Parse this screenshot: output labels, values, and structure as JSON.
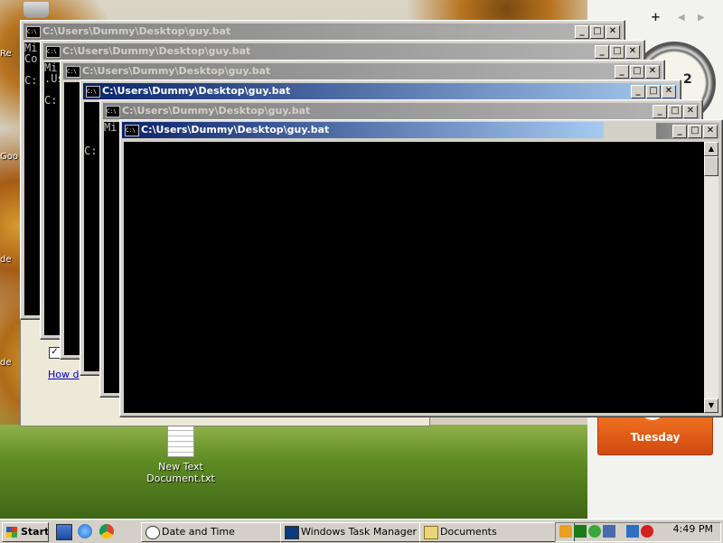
{
  "desktop": {
    "icons": [
      {
        "name": "New Text Document.txt",
        "label_line1": "New Text",
        "label_line2": "Document.txt"
      }
    ],
    "edge_labels": [
      "Re",
      "Goo",
      "de",
      "de"
    ]
  },
  "gadgets": {
    "toolbar": {
      "add": "+",
      "prev": "◀",
      "next": "▶"
    },
    "clock": {
      "visible_number": "2"
    },
    "calendar": {
      "day": "Tuesday"
    }
  },
  "date_time_dialog": {
    "link_text": "How d",
    "checkbox_checked": true
  },
  "console_windows": [
    {
      "title": "C:\\Users\\Dummy\\Desktop\\guy.bat",
      "active": false,
      "console_text": "Mi\nCo\n\nC:"
    },
    {
      "title": "C:\\Users\\Dummy\\Desktop\\guy.bat",
      "active": false,
      "console_text": "Mi\n.Us\n\nC:"
    },
    {
      "title": "C:\\Users\\Dummy\\Desktop\\guy.bat",
      "active": false,
      "console_text": ""
    },
    {
      "title": "C:\\Users\\Dummy\\Desktop\\guy.bat",
      "active": true,
      "console_text": "\n\n\n\nC:"
    },
    {
      "title": "C:\\Users\\Dummy\\Desktop\\guy.bat",
      "active": false,
      "console_text": "Mi"
    },
    {
      "title": "C:\\Users\\Dummy\\Desktop\\guy.bat",
      "active": true,
      "console_text": ""
    }
  ],
  "window_buttons": {
    "minimize": "_",
    "maximize": "□",
    "close": "✕"
  },
  "taskbar": {
    "start_label": "Start",
    "tasks": [
      {
        "label": "Date and Time",
        "icon": "clock-icon"
      },
      {
        "label": "Windows Task Manager",
        "icon": "task-manager-icon"
      },
      {
        "label": "Documents",
        "icon": "folder-icon"
      }
    ],
    "clock": "4:49 PM"
  }
}
